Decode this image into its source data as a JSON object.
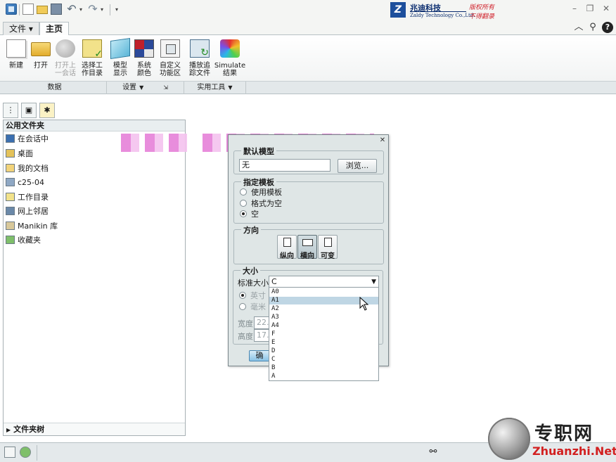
{
  "brand": {
    "logo_letters": "Z",
    "name_cn": "兆迪科技",
    "name_en": "Zaldy Technology Co.,Ltd.",
    "rights_line1": "版权所有",
    "rights_line2": "不得翻录"
  },
  "ribbon": {
    "tabs": [
      {
        "label": "文件 ▾"
      },
      {
        "label": "主页"
      }
    ],
    "buttons": [
      {
        "label": "新建",
        "icon": "new-document-icon"
      },
      {
        "label": "打开",
        "icon": "open-folder-icon"
      },
      {
        "label": "打开上\n一会话",
        "icon": "open-session-icon",
        "disabled": true
      },
      {
        "label": "选择工\n作目录",
        "icon": "working-directory-icon"
      },
      {
        "label": "模型\n显示",
        "icon": "model-display-icon"
      },
      {
        "label": "系统\n颜色",
        "icon": "system-color-icon"
      },
      {
        "label": "自定义\n功能区",
        "icon": "customize-ribbon-icon"
      },
      {
        "label": "播放追\n踪文件",
        "icon": "play-trail-icon"
      },
      {
        "label": "Simulate\n结果",
        "icon": "simulate-results-icon"
      }
    ],
    "groups": [
      {
        "label": "数据"
      },
      {
        "label": "设置"
      },
      {
        "label": "实用工具"
      }
    ]
  },
  "navigator": {
    "header": "公用文件夹",
    "items": [
      {
        "label": "在会话中",
        "icon": "session-icon"
      },
      {
        "label": "桌面",
        "icon": "desktop-icon"
      },
      {
        "label": "我的文档",
        "icon": "my-documents-icon"
      },
      {
        "label": "c25-04",
        "icon": "computer-icon"
      },
      {
        "label": "工作目录",
        "icon": "working-directory-icon"
      },
      {
        "label": "网上邻居",
        "icon": "network-icon"
      },
      {
        "label": "Manikin 库",
        "icon": "manikin-library-icon"
      },
      {
        "label": "收藏夹",
        "icon": "favorites-icon"
      }
    ],
    "footer": "文件夹树"
  },
  "dialog": {
    "section_top_label": "默认模型",
    "model_value": "无",
    "browse_label": "浏览...",
    "template_legend": "指定模板",
    "template_options": [
      {
        "label": "使用模板",
        "selected": false
      },
      {
        "label": "格式为空",
        "selected": false
      },
      {
        "label": "空",
        "selected": true
      }
    ],
    "orientation_legend": "方向",
    "orientation_buttons": [
      {
        "label": "纵向",
        "selected": false
      },
      {
        "label": "横向",
        "selected": true
      },
      {
        "label": "可变",
        "selected": false
      }
    ],
    "size_legend": "大小",
    "standard_size_label": "标准大小",
    "standard_size_value": "C",
    "unit_options": [
      {
        "label": "英寸",
        "selected": true
      },
      {
        "label": "毫米",
        "selected": false
      }
    ],
    "width_label": "宽度",
    "width_value": "22.0",
    "height_label": "高度",
    "height_value": "17.0",
    "ok_label": "确",
    "size_options": [
      "A0",
      "A1",
      "A2",
      "A3",
      "A4",
      "F",
      "E",
      "D",
      "C",
      "B",
      "A"
    ],
    "highlighted_option": "A1"
  },
  "watermark": {
    "title": "专职网",
    "url": "Zhuanzhi.Net"
  }
}
